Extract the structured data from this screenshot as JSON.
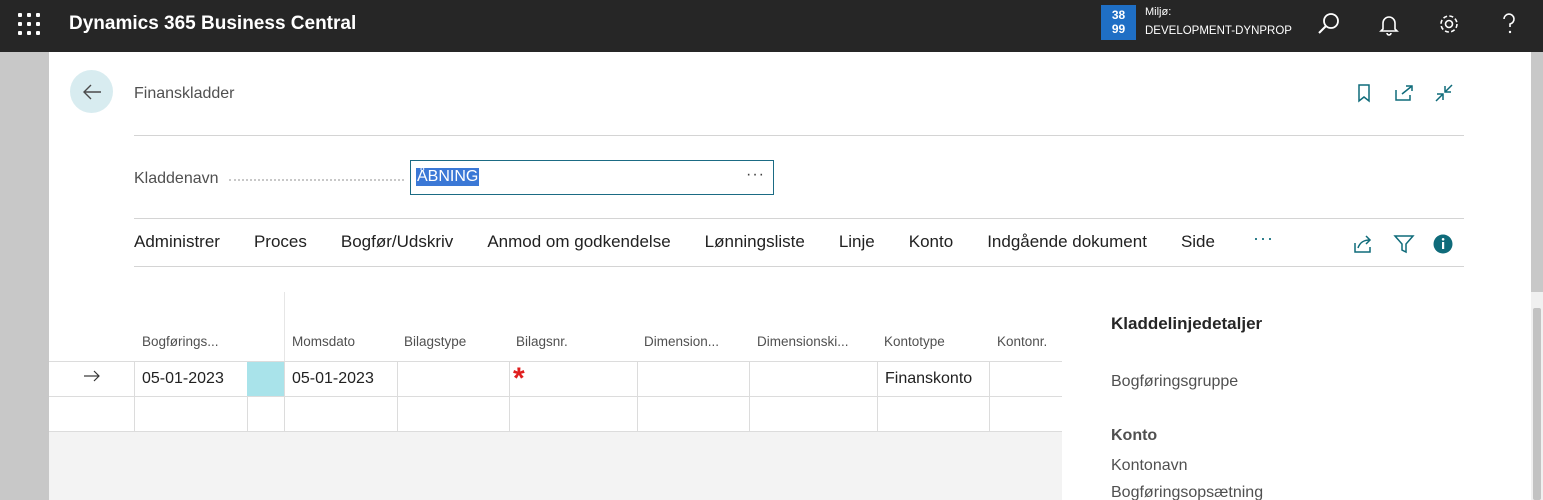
{
  "topbar": {
    "app_title": "Dynamics 365 Business Central",
    "env_badge_line1": "38",
    "env_badge_line2": "99",
    "env_label": "Miljø:",
    "env_name": "DEVELOPMENT-DYNPROP",
    "icons": [
      "waffle-icon",
      "search-icon",
      "bell-icon",
      "gear-icon",
      "help-icon"
    ]
  },
  "page": {
    "title": "Finanskladder",
    "icons": [
      "bookmark-icon",
      "open-new-window-icon",
      "collapse-icon"
    ]
  },
  "journal": {
    "label": "Kladdenavn",
    "value": "ÅBNING",
    "lookup": "···"
  },
  "actions": {
    "items": [
      "Administrer",
      "Proces",
      "Bogfør/Udskriv",
      "Anmod om godkendelse",
      "Lønningsliste",
      "Linje",
      "Konto",
      "Indgående dokument",
      "Side"
    ],
    "more": "···",
    "icons": [
      "share-icon",
      "filter-icon",
      "info-icon"
    ]
  },
  "grid": {
    "columns": [
      "Bogførings...",
      "",
      "Momsdato",
      "Bilagstype",
      "Bilagsnr.",
      "Dimension...",
      "Dimensionski...",
      "Kontotype",
      "Kontonr."
    ],
    "rows": [
      [
        "05-01-2023",
        "",
        "05-01-2023",
        "",
        "*",
        "",
        "",
        "Finanskonto",
        ""
      ],
      [
        "",
        "",
        "",
        "",
        "",
        "",
        "",
        "",
        ""
      ]
    ]
  },
  "factbox": {
    "title": "Kladdelinjedetaljer",
    "posting_group": "Bogføringsgruppe",
    "account_head": "Konto",
    "account_name": "Kontonavn",
    "posting_setup": "Bogføringsopsætning"
  },
  "colors": {
    "topbar": "#262626",
    "env_badge": "#1f6fc5",
    "accent": "#0f6b7a",
    "selection": "#3b78d6",
    "selected_cell": "#a9e3ea",
    "required": "#e01e1e"
  }
}
